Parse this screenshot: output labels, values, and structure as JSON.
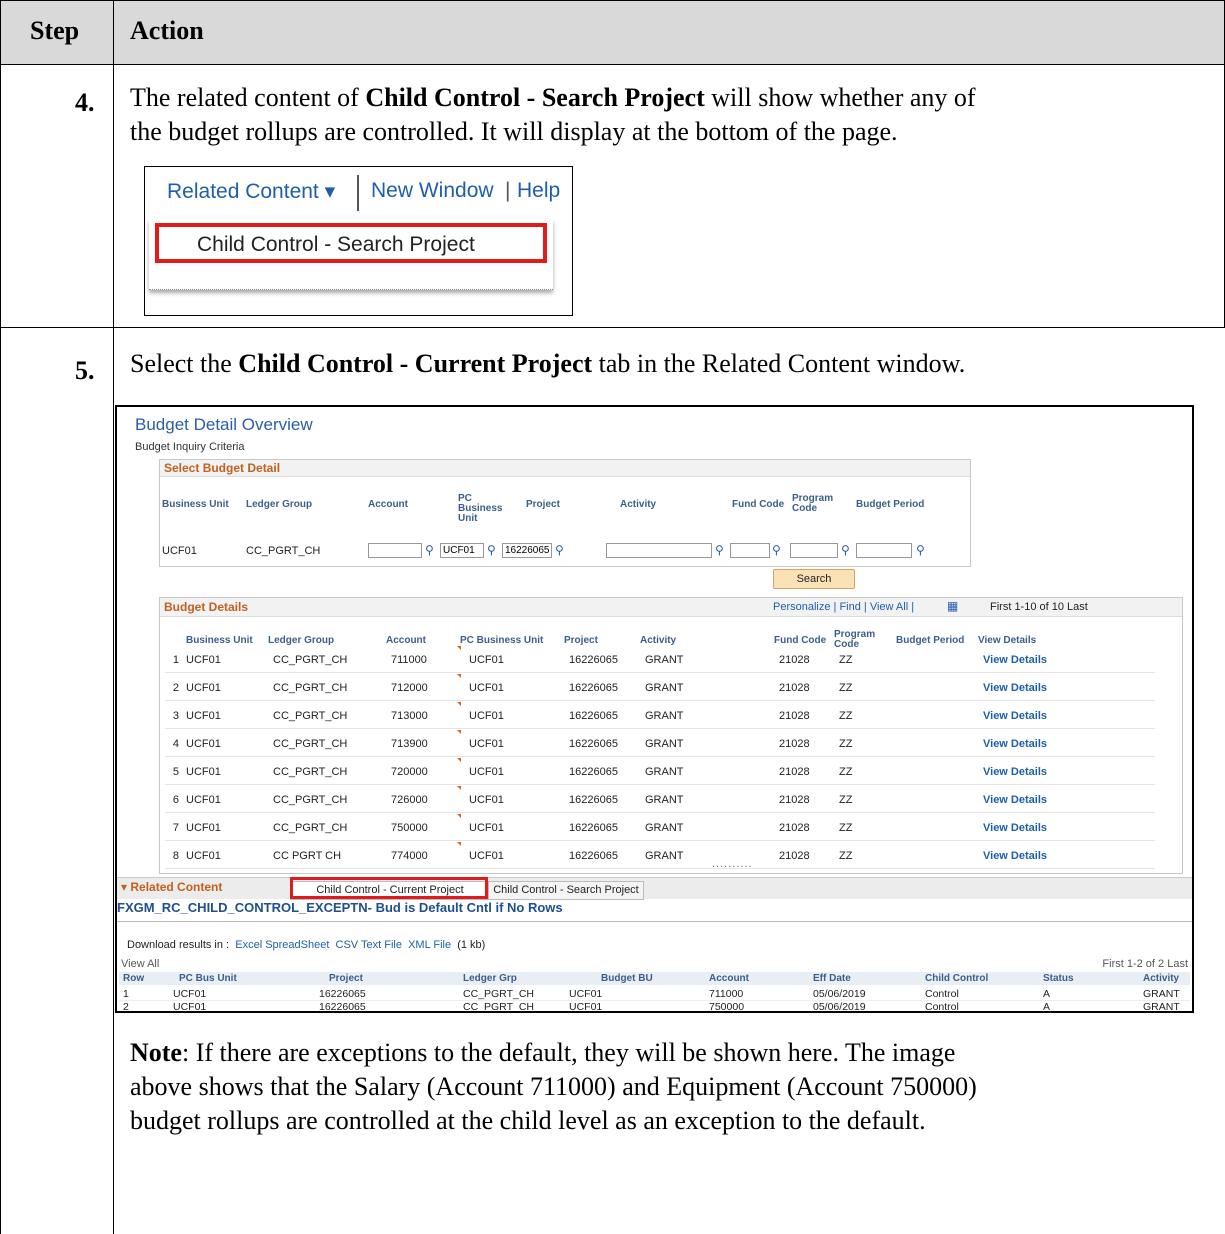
{
  "header": {
    "step": "Step",
    "action": "Action"
  },
  "step4": {
    "number": "4.",
    "line1_pre": "The related content of ",
    "line1_bold": "Child Control - Search Project",
    "line1_post": " will show whether any of",
    "line2": "the budget rollups are controlled. It will display at the bottom of the page."
  },
  "menu": {
    "related_content": "Related Content ▾",
    "new_window": "New Window",
    "help": "Help",
    "dropdown_item": "Child Control - Search Project"
  },
  "step5": {
    "number": "5.",
    "pre": "Select the ",
    "bold": "Child Control - Current Project",
    "post": " tab in the Related Content window."
  },
  "budget": {
    "title": "Budget Detail Overview",
    "criteria": "Budget Inquiry Criteria",
    "select_header": "Select Budget Detail",
    "select_cols": [
      "Business Unit",
      "Ledger Group",
      "Account",
      "PC Business Unit",
      "Project",
      "Activity",
      "Fund Code",
      "Program Code",
      "Budget Period"
    ],
    "select_values": {
      "business_unit": "UCF01",
      "ledger_group": "CC_PGRT_CH",
      "pc_bu": "UCF01",
      "project": "16226065"
    },
    "search_button": "Search",
    "details_header": "Budget Details",
    "toolbar": "Personalize | Find | View All |",
    "nav": "First  1-10 of 10  Last",
    "detail_cols": [
      "Business Unit",
      "Ledger Group",
      "Account",
      "PC Business Unit",
      "Project",
      "Activity",
      "Fund Code",
      "Program Code",
      "Budget Period",
      "View Details"
    ],
    "rows": [
      {
        "n": "1",
        "bu": "UCF01",
        "lg": "CC_PGRT_CH",
        "acct": "711000",
        "pcbu": "UCF01",
        "proj": "16226065",
        "act": "GRANT",
        "fund": "21028",
        "prog": "ZZ",
        "vd": "View Details"
      },
      {
        "n": "2",
        "bu": "UCF01",
        "lg": "CC_PGRT_CH",
        "acct": "712000",
        "pcbu": "UCF01",
        "proj": "16226065",
        "act": "GRANT",
        "fund": "21028",
        "prog": "ZZ",
        "vd": "View Details"
      },
      {
        "n": "3",
        "bu": "UCF01",
        "lg": "CC_PGRT_CH",
        "acct": "713000",
        "pcbu": "UCF01",
        "proj": "16226065",
        "act": "GRANT",
        "fund": "21028",
        "prog": "ZZ",
        "vd": "View Details"
      },
      {
        "n": "4",
        "bu": "UCF01",
        "lg": "CC_PGRT_CH",
        "acct": "713900",
        "pcbu": "UCF01",
        "proj": "16226065",
        "act": "GRANT",
        "fund": "21028",
        "prog": "ZZ",
        "vd": "View Details"
      },
      {
        "n": "5",
        "bu": "UCF01",
        "lg": "CC_PGRT_CH",
        "acct": "720000",
        "pcbu": "UCF01",
        "proj": "16226065",
        "act": "GRANT",
        "fund": "21028",
        "prog": "ZZ",
        "vd": "View Details"
      },
      {
        "n": "6",
        "bu": "UCF01",
        "lg": "CC_PGRT_CH",
        "acct": "726000",
        "pcbu": "UCF01",
        "proj": "16226065",
        "act": "GRANT",
        "fund": "21028",
        "prog": "ZZ",
        "vd": "View Details"
      },
      {
        "n": "7",
        "bu": "UCF01",
        "lg": "CC_PGRT_CH",
        "acct": "750000",
        "pcbu": "UCF01",
        "proj": "16226065",
        "act": "GRANT",
        "fund": "21028",
        "prog": "ZZ",
        "vd": "View Details"
      },
      {
        "n": "8",
        "bu": "UCF01",
        "lg": "CC PGRT CH",
        "acct": "774000",
        "pcbu": "UCF01",
        "proj": "16226065",
        "act": "GRANT",
        "fund": "21028",
        "prog": "ZZ",
        "vd": "View Details"
      }
    ]
  },
  "related": {
    "header": "Related Content",
    "tab_current": "Child Control - Current Project",
    "tab_search": "Child Control - Search Project",
    "query_title": "FXGM_RC_CHILD_CONTROL_EXCEPTN- Bud is Default Cntl if No Rows",
    "download_label": "Download results in :",
    "excel": "Excel SpreadSheet",
    "csv": "CSV Text File",
    "xml": "XML File",
    "size": "(1 kb)",
    "view_all": "View All",
    "pager": "First  1-2 of 2  Last",
    "cols": [
      "Row",
      "PC Bus Unit",
      "Project",
      "Ledger Grp",
      "Budget BU",
      "Account",
      "Eff Date",
      "Child Control",
      "Status",
      "Activity"
    ],
    "rows": [
      [
        "1",
        "UCF01",
        "16226065",
        "CC_PGRT_CH",
        "UCF01",
        "711000",
        "05/06/2019",
        "Control",
        "A",
        "GRANT"
      ],
      [
        "2",
        "UCF01",
        "16226065",
        "CC_PGRT_CH",
        "UCF01",
        "750000",
        "05/06/2019",
        "Control",
        "A",
        "GRANT"
      ]
    ]
  },
  "note": {
    "label": "Note",
    "line1": ": If there are exceptions to the default, they will be shown here. The image",
    "line2": "above shows that the Salary (Account 711000) and Equipment (Account 750000)",
    "line3": "budget rollups are controlled at the child level as an exception to the default."
  }
}
